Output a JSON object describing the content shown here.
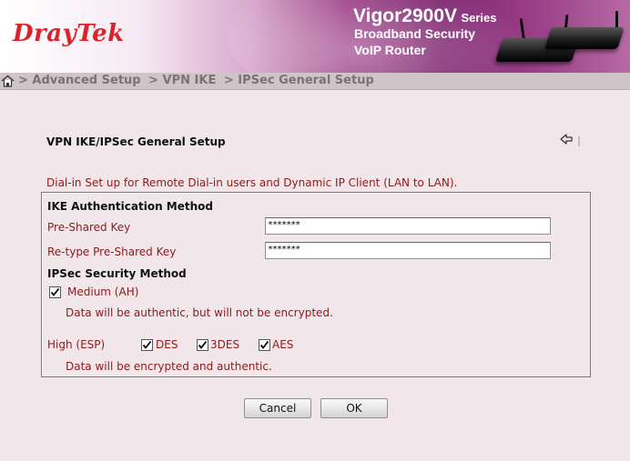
{
  "header": {
    "logo": "DrayTek",
    "model": "Vigor2900V",
    "series": "Series",
    "line1": "Broadband Security",
    "line2": "VoIP Router"
  },
  "breadcrumb": {
    "items": [
      "> Advanced Setup",
      "> VPN IKE",
      "> IPSec General Setup"
    ]
  },
  "page": {
    "title": "VPN IKE/IPSec General Setup",
    "intro": "Dial-in Set up for Remote Dial-in users and Dynamic IP Client (LAN to LAN)."
  },
  "ike": {
    "section_title": "IKE Authentication Method",
    "psk_label": "Pre-Shared Key",
    "psk_value": "*******",
    "retype_label": "Re-type Pre-Shared Key",
    "retype_value": "*******"
  },
  "ipsec": {
    "section_title": "IPSec Security Method",
    "medium_label": "Medium (AH)",
    "medium_checked": true,
    "medium_note": "Data will be authentic, but will not be encrypted.",
    "high_label": "High (ESP)",
    "des_label": "DES",
    "des_checked": true,
    "tdes_label": "3DES",
    "tdes_checked": true,
    "aes_label": "AES",
    "aes_checked": true,
    "high_note": "Data will be encrypted and authentic."
  },
  "buttons": {
    "cancel": "Cancel",
    "ok": "OK"
  },
  "colors": {
    "background": "#f1e7ea",
    "label_text": "#8b1a1a",
    "logo_red": "#d8242a",
    "banner_purple": "#7e2670"
  }
}
